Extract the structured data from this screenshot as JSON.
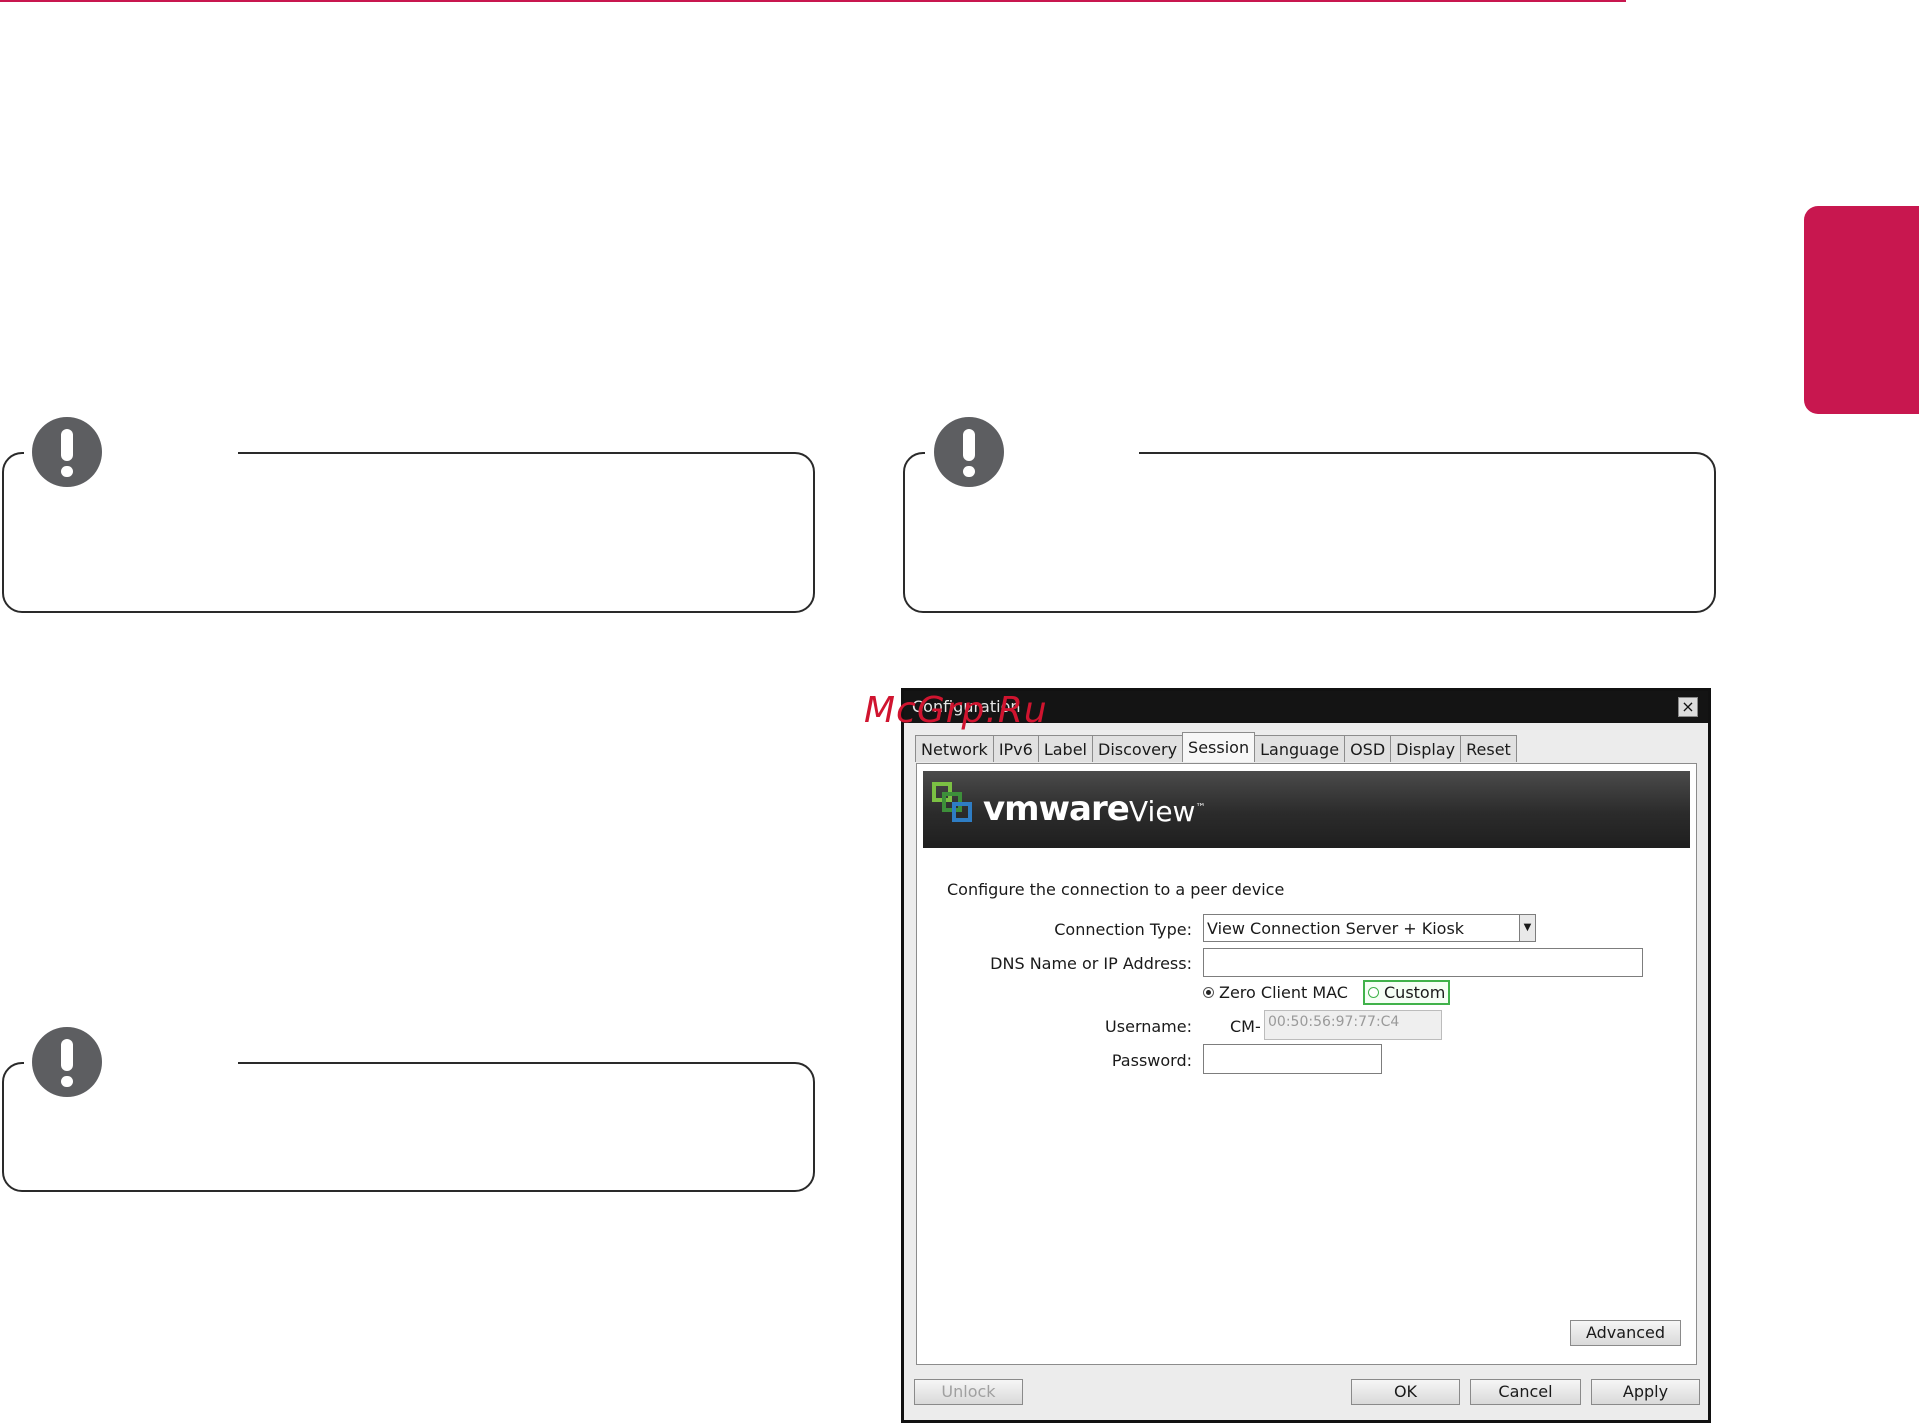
{
  "colors": {
    "accent": "#c8174f",
    "note_icon": "#5d5e61",
    "watermark": "#d0142f",
    "banner": "#2b2b2b",
    "custom_highlight": "#40b24a"
  },
  "watermark": "McGrp.Ru",
  "notes": [
    {
      "icon": "exclamation-icon"
    },
    {
      "icon": "exclamation-icon"
    },
    {
      "icon": "exclamation-icon"
    }
  ],
  "dialog": {
    "title": "Configuration",
    "close_label": "×",
    "tabs": [
      "Network",
      "IPv6",
      "Label",
      "Discovery",
      "Session",
      "Language",
      "OSD",
      "Display",
      "Reset"
    ],
    "active_tab": "Session",
    "banner": {
      "brand": "vmware",
      "product": "View",
      "trademark": "™"
    },
    "intro": "Configure the connection to a peer device",
    "connection_type_label": "Connection Type:",
    "connection_type_value": "View Connection Server + Kiosk",
    "dns_label": "DNS Name or IP Address:",
    "dns_value": "",
    "radio_zero_client": "Zero Client MAC",
    "radio_custom": "Custom",
    "selected_radio": "Zero Client MAC",
    "username_label": "Username:",
    "username_prefix": "CM-",
    "username_value": "00:50:56:97:77:C4",
    "password_label": "Password:",
    "password_value": "",
    "advanced_button": "Advanced",
    "unlock_button": "Unlock",
    "ok_button": "OK",
    "cancel_button": "Cancel",
    "apply_button": "Apply"
  }
}
